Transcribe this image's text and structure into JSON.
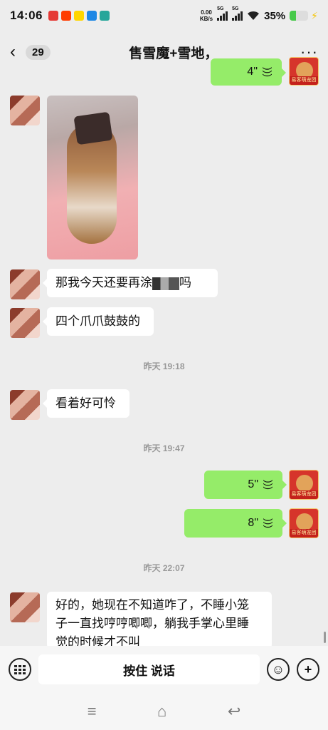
{
  "status_bar": {
    "time": "14:06",
    "net_speed_value": "0.00",
    "net_speed_unit": "KB/s",
    "sim1_label": "5G",
    "sim2_label": "5G",
    "battery_percent_text": "35%",
    "battery_level": 0.35,
    "notif_colors": [
      "#e53935",
      "#ff3d00",
      "#ffd600",
      "#1e88e5",
      "#26a69a"
    ]
  },
  "header": {
    "back_icon": "chevron-left-icon",
    "unread_count": "29",
    "title": "售雪魔+雪地，",
    "more_icon": "more-dots-icon"
  },
  "messages": {
    "top_voice_duration": "4\"",
    "them_1_text_a": "那我今天还要再涂",
    "them_1_text_b": "吗",
    "them_2_text": "四个爪爪鼓鼓的",
    "sep_1": "昨天 19:18",
    "them_3_text": "看着好可怜",
    "sep_2": "昨天 19:47",
    "me_voice_1": "5\"",
    "me_voice_2": "8\"",
    "sep_3": "昨天 22:07",
    "them_4_line1": "好的，她现在不知道咋了，不睡小笼",
    "them_4_line2": "子一直找哼哼唧唧，躺我手掌心里睡",
    "them_4_line3": "觉的时候才不叫",
    "me_avatar_caption": "易客萌宠团队"
  },
  "input_bar": {
    "keyboard_icon": "keyboard-icon",
    "hold_to_talk": "按住 说话",
    "emoji_icon": "emoji-icon",
    "plus_icon": "plus-icon"
  },
  "nav_bar": {
    "menu_icon": "menu-icon",
    "home_icon": "home-icon",
    "back_icon": "back-icon"
  }
}
